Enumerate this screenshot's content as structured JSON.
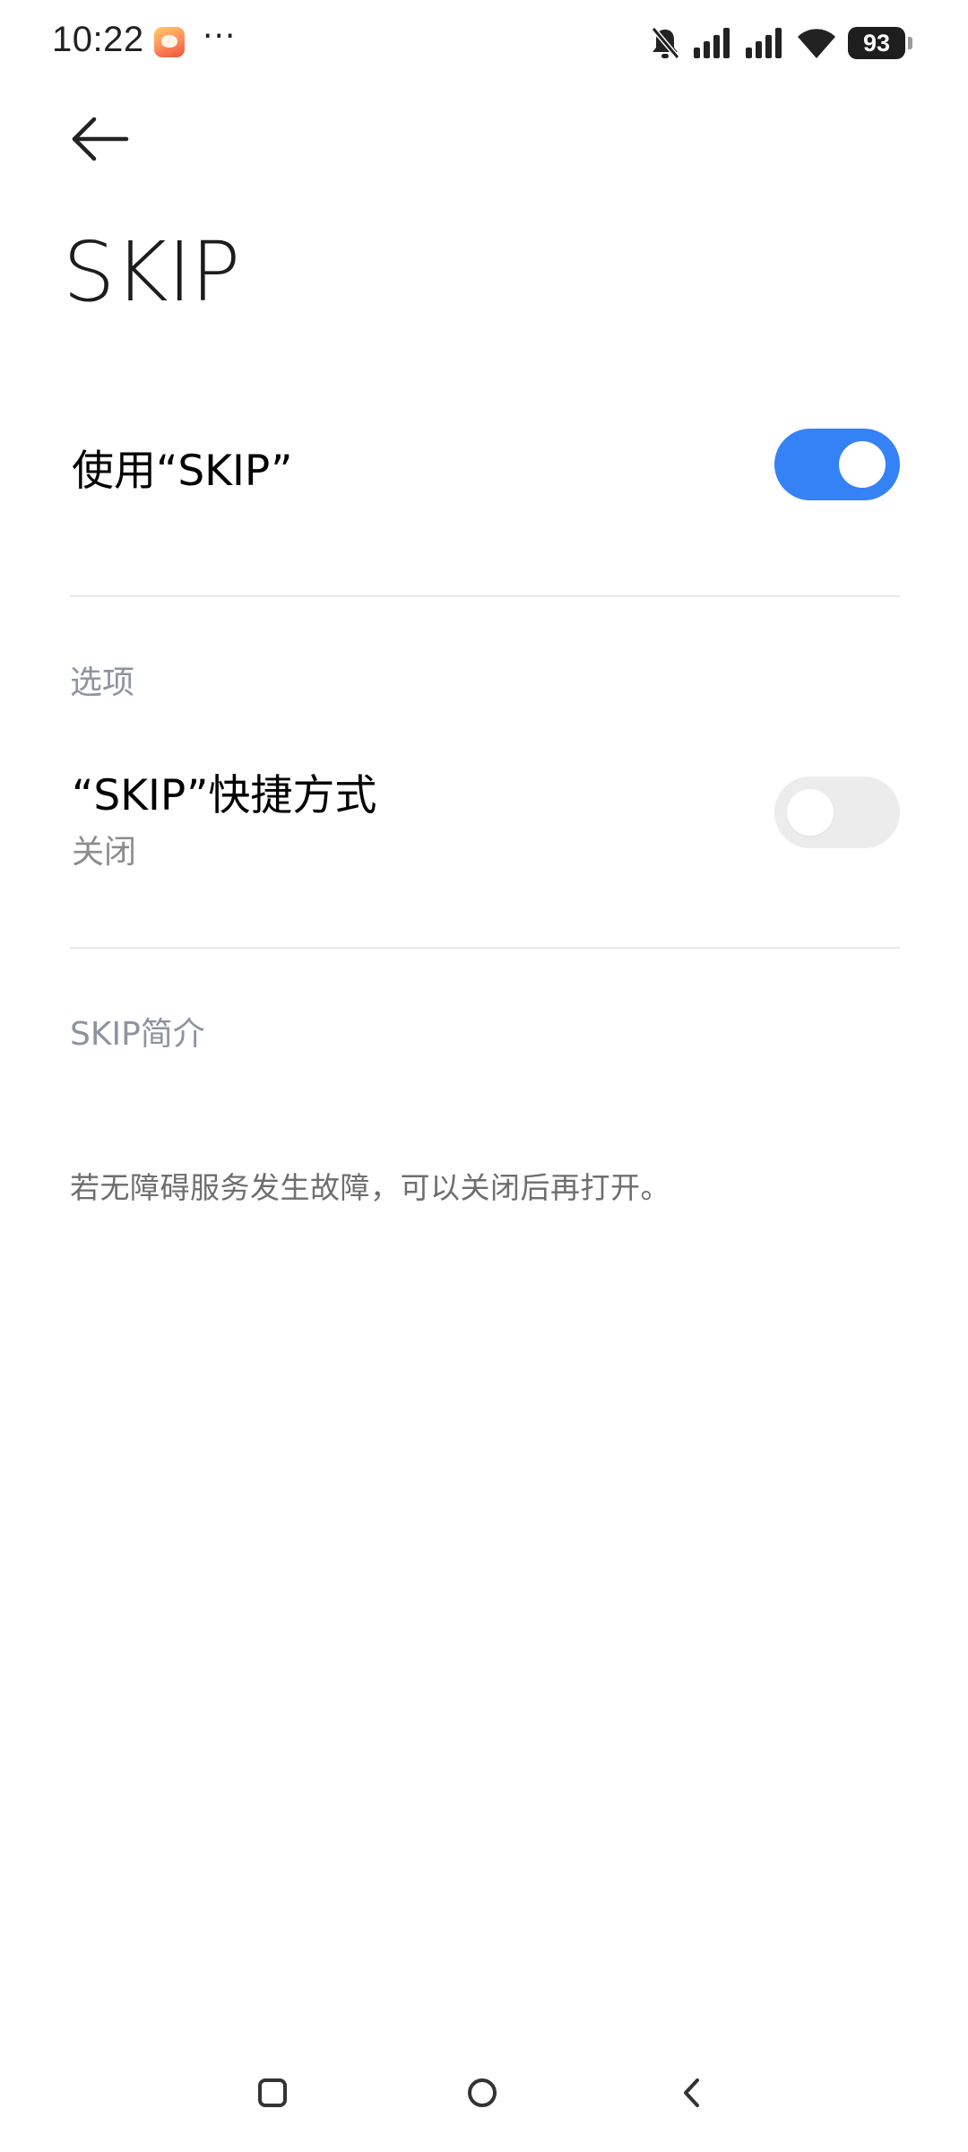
{
  "status_bar": {
    "time": "10:22",
    "more": "···",
    "battery_level": "93",
    "icons": [
      "app-notification-icon",
      "bell-off-icon",
      "signal-icon",
      "signal-icon",
      "wifi-icon",
      "battery-icon"
    ]
  },
  "header": {
    "back_icon": "arrow-left-icon",
    "title": "SKIP"
  },
  "main_toggle": {
    "label": "使用“SKIP”",
    "enabled": true
  },
  "options_section": {
    "header": "选项",
    "shortcut": {
      "label": "“SKIP”快捷方式",
      "status": "关闭",
      "enabled": false
    }
  },
  "intro_section": {
    "header": "SKIP简介",
    "text": "若无障碍服务发生故障，可以关闭后再打开。"
  },
  "nav_bar": {
    "buttons": [
      "recents-square-icon",
      "home-circle-icon",
      "back-chevron-icon"
    ]
  },
  "colors": {
    "accent": "#3482f6",
    "toggle_off": "#ececec",
    "section_header": "#8e93a0",
    "divider": "#e8e8e8"
  }
}
